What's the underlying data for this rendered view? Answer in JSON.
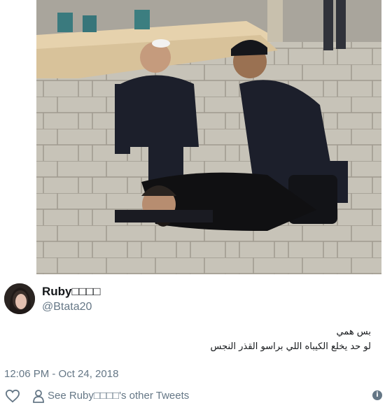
{
  "tweet": {
    "photo_alt": "Photo",
    "author": {
      "display_name": "Ruby□□□□",
      "handle": "@Btata20"
    },
    "text_lines": [
      "بس همي",
      "لو حد يخلع الكيباه اللي براسو القذر النجس"
    ],
    "timestamp": "12:06 PM - Oct 24, 2018",
    "footer": {
      "like_icon": "heart-icon",
      "profile_icon": "person-icon",
      "other_tweets_link": "See Ruby□□□□'s other Tweets",
      "info_icon": "info-icon",
      "info_glyph": "i"
    }
  },
  "colors": {
    "text_primary": "#14171a",
    "text_secondary": "#657786",
    "background": "#ffffff"
  }
}
